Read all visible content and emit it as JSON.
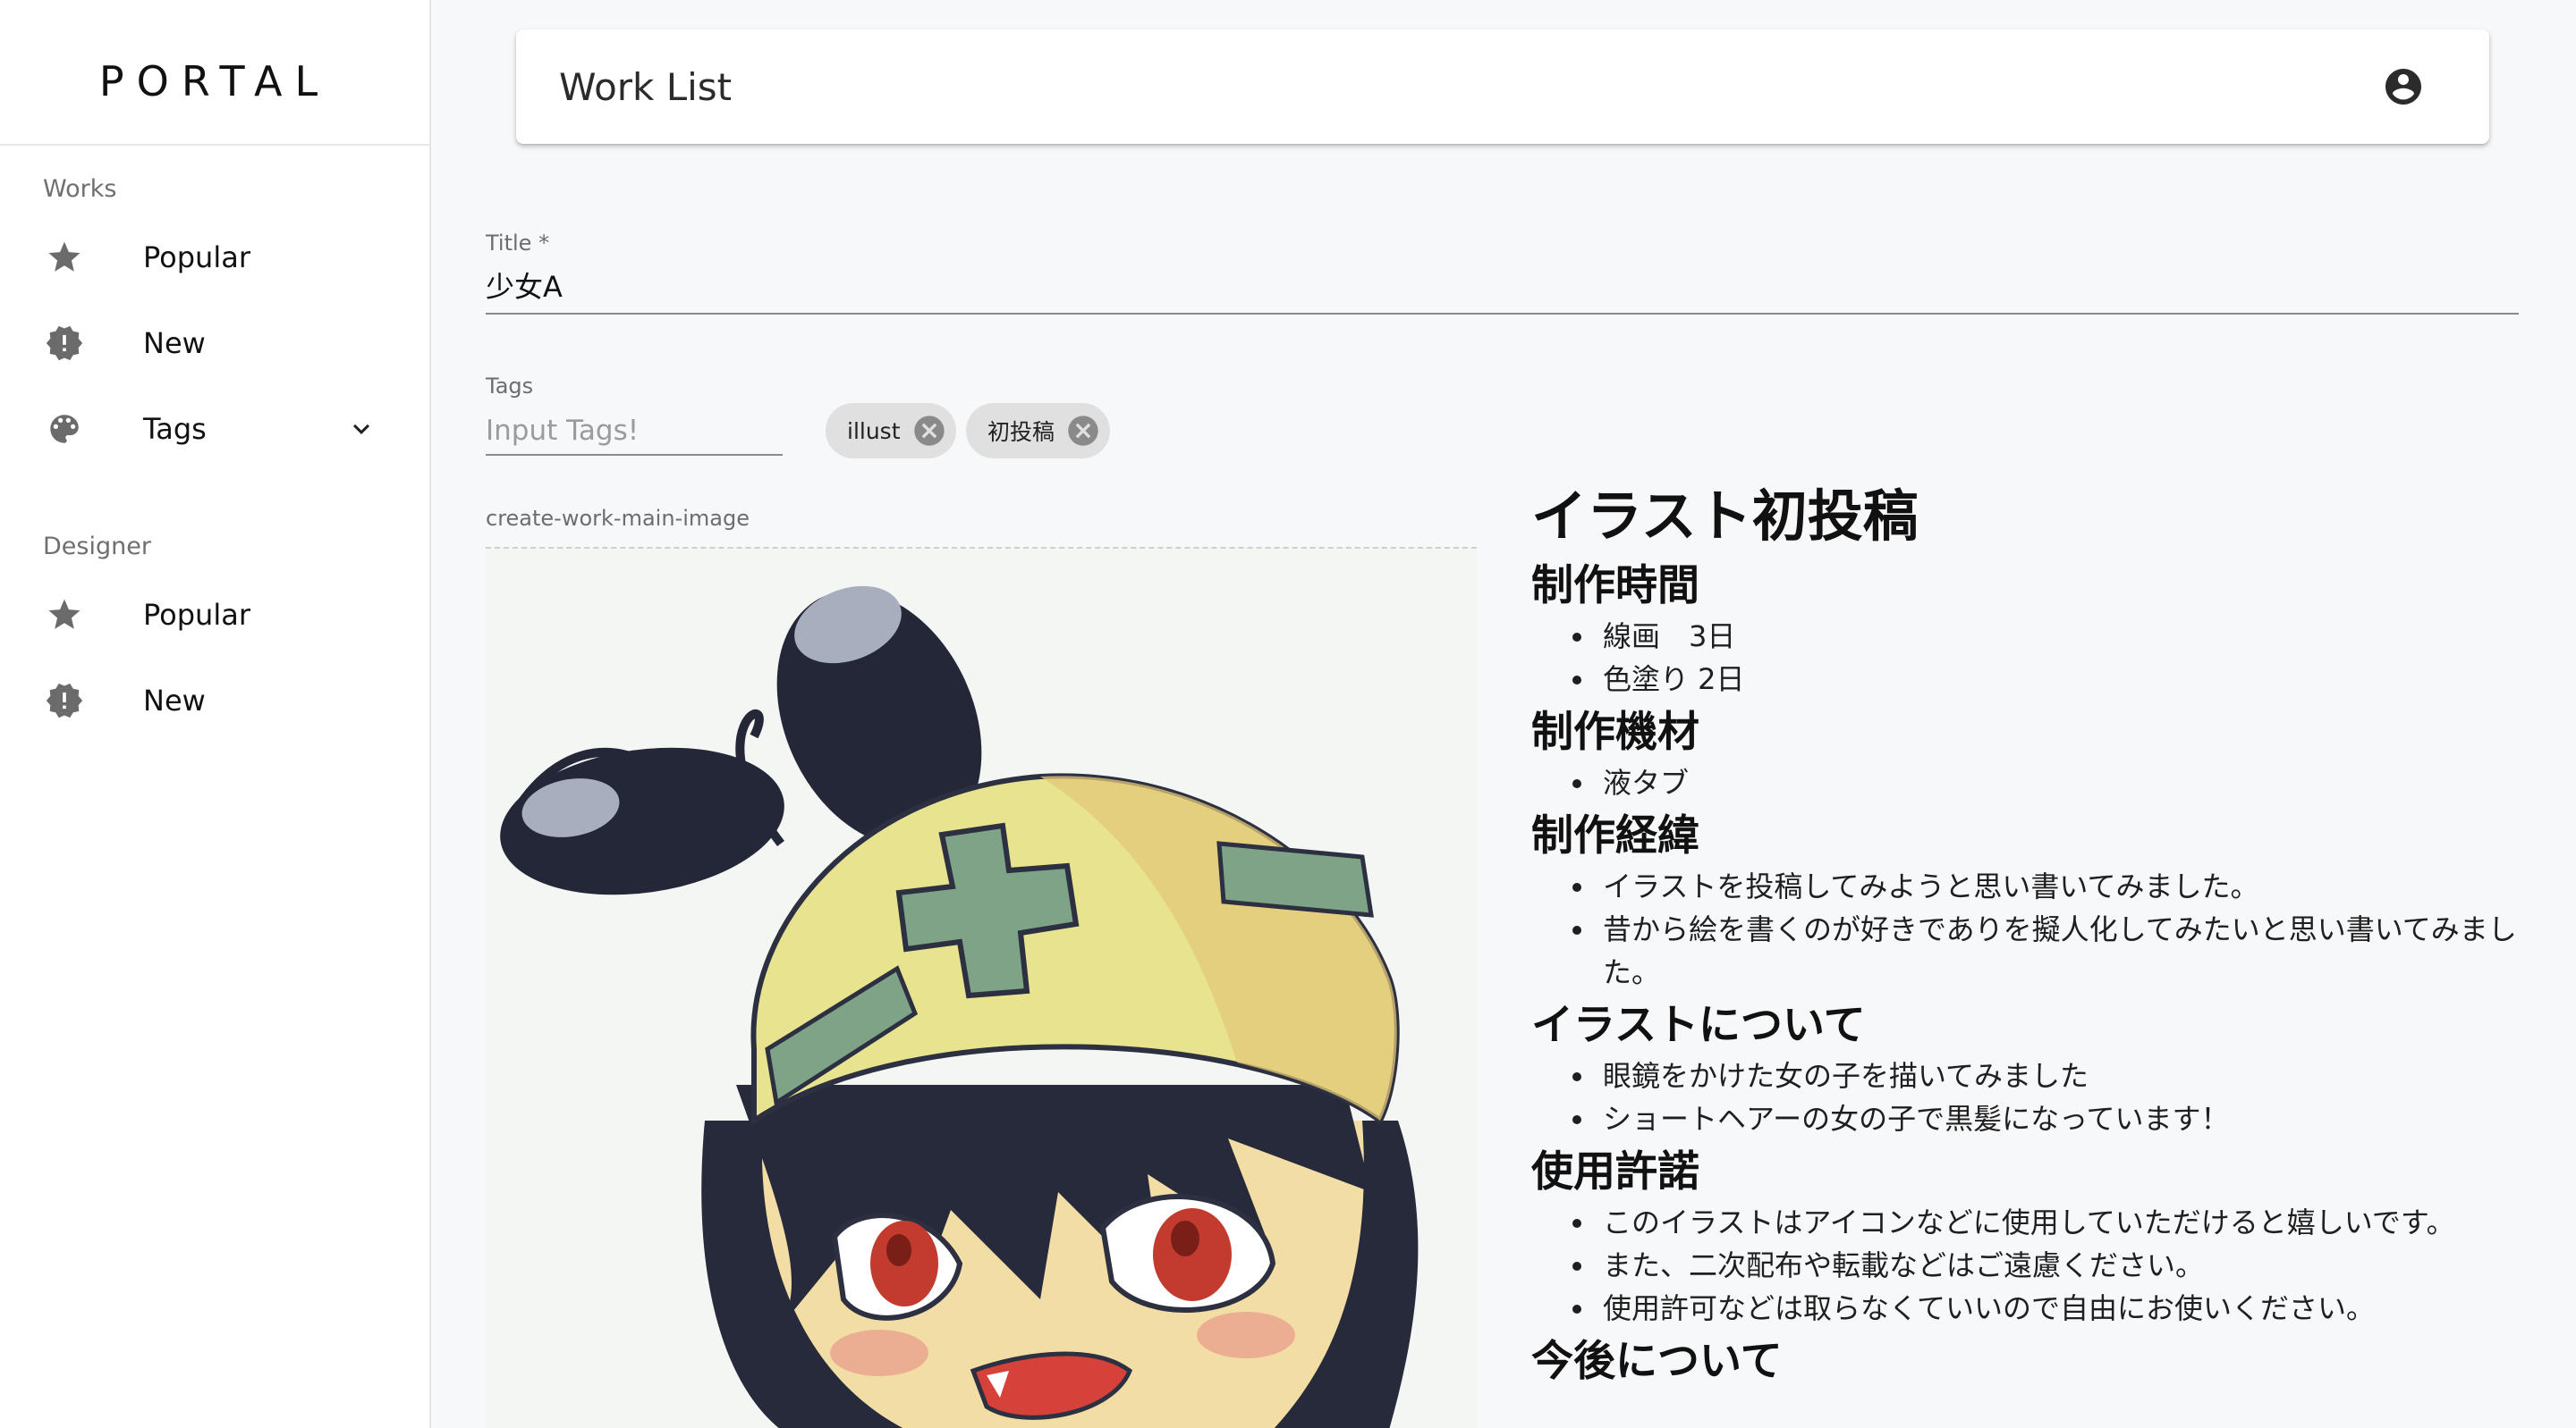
{
  "sidebar": {
    "brand": "PORTAL",
    "works": {
      "heading": "Works",
      "items": [
        {
          "label": "Popular",
          "icon": "star-icon"
        },
        {
          "label": "New",
          "icon": "new-badge-icon"
        },
        {
          "label": "Tags",
          "icon": "palette-icon"
        }
      ]
    },
    "designer": {
      "heading": "Designer",
      "items": [
        {
          "label": "Popular",
          "icon": "star-icon"
        },
        {
          "label": "New",
          "icon": "new-badge-icon"
        }
      ]
    }
  },
  "header": {
    "title": "Work List",
    "account_icon": "account-circle-icon"
  },
  "form": {
    "title_label": "Title *",
    "title_value": "少女A",
    "tags_label": "Tags",
    "tags_placeholder": "Input Tags!",
    "tags": [
      "illust",
      "初投稿"
    ],
    "image_label": "create-work-main-image"
  },
  "preview": {
    "title": "イラスト初投稿",
    "sections": [
      {
        "heading": "制作時間",
        "items": [
          "線画　3日",
          "色塗り 2日"
        ]
      },
      {
        "heading": "制作機材",
        "items": [
          "液タブ"
        ]
      },
      {
        "heading": "制作経緯",
        "items": [
          "イラストを投稿してみようと思い書いてみました。",
          "昔から絵を書くのが好きでありを擬人化してみたいと思い書いてみました。"
        ]
      },
      {
        "heading": "イラストについて",
        "items": [
          "眼鏡をかけた女の子を描いてみました",
          "ショートヘアーの女の子で黒髪になっています！"
        ]
      },
      {
        "heading": "使用許諾",
        "items": [
          "このイラストはアイコンなどに使用していただけると嬉しいです。",
          "また、二次配布や転載などはご遠慮ください。",
          "使用許可などは取らなくていいので自由にお使いください。"
        ]
      },
      {
        "heading": "今後について",
        "items": []
      }
    ]
  },
  "colors": {
    "background": "#f7f8fa",
    "sidebar": "#ffffff",
    "chip": "#e0e0e0",
    "icon": "#6b6b6b"
  }
}
